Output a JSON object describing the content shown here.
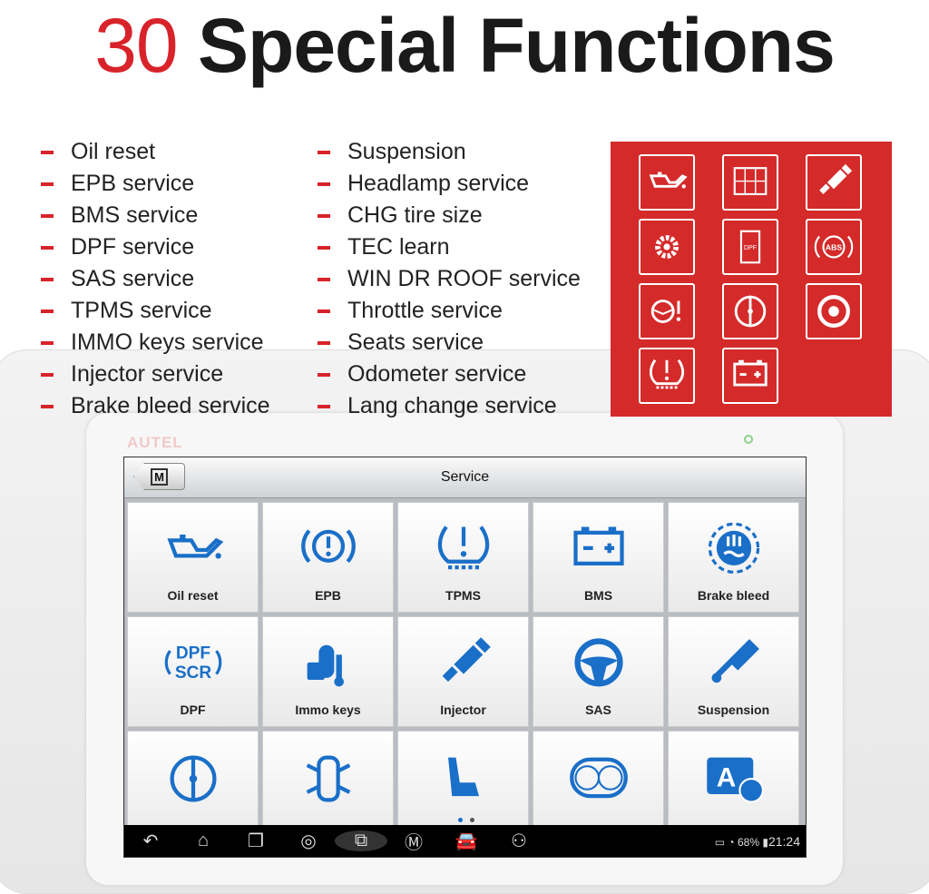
{
  "heading": {
    "number": "30",
    "text": "Special Functions"
  },
  "functions_left": [
    "Oil reset",
    "EPB service",
    "BMS service",
    "DPF service",
    "SAS service",
    "TPMS service",
    "IMMO keys service",
    "Injector service",
    "Brake bleed service"
  ],
  "functions_right": [
    "Suspension",
    "Headlamp service",
    "CHG tire size",
    "TEC learn",
    "WIN DR ROOF service",
    "Throttle service",
    "Seats service",
    "Odometer service",
    "Lang change service"
  ],
  "panel_icons": [
    "oil-can",
    "window-lock",
    "injector",
    "gear",
    "dpf",
    "abs",
    "steering-warning",
    "throttle",
    "tire",
    "tpms",
    "battery"
  ],
  "device": {
    "brand": "AUTEL"
  },
  "screen": {
    "title": "Service",
    "home_label": "M",
    "tiles": [
      {
        "label": "Oil reset",
        "icon": "oil-can"
      },
      {
        "label": "EPB",
        "icon": "epb"
      },
      {
        "label": "TPMS",
        "icon": "tpms"
      },
      {
        "label": "BMS",
        "icon": "battery"
      },
      {
        "label": "Brake bleed",
        "icon": "brake-bleed"
      },
      {
        "label": "DPF",
        "icon": "dpf-scr"
      },
      {
        "label": "Immo keys",
        "icon": "keys"
      },
      {
        "label": "Injector",
        "icon": "injector"
      },
      {
        "label": "SAS",
        "icon": "steering-wheel"
      },
      {
        "label": "Suspension",
        "icon": "suspension"
      },
      {
        "label": "",
        "icon": "throttle"
      },
      {
        "label": "",
        "icon": "car-doors"
      },
      {
        "label": "",
        "icon": "seat"
      },
      {
        "label": "",
        "icon": "odometer"
      },
      {
        "label": "",
        "icon": "language"
      }
    ],
    "page_indicator": {
      "pages": 2,
      "current": 1
    },
    "nav_icons": [
      "back",
      "home",
      "recent-apps",
      "chrome",
      "screenshot",
      "autel-home",
      "car",
      "remote-expert"
    ],
    "status": {
      "battery": "68%",
      "time": "21:24"
    }
  },
  "colors": {
    "accent": "#d8232a",
    "icon_blue": "#1a6fc8"
  }
}
